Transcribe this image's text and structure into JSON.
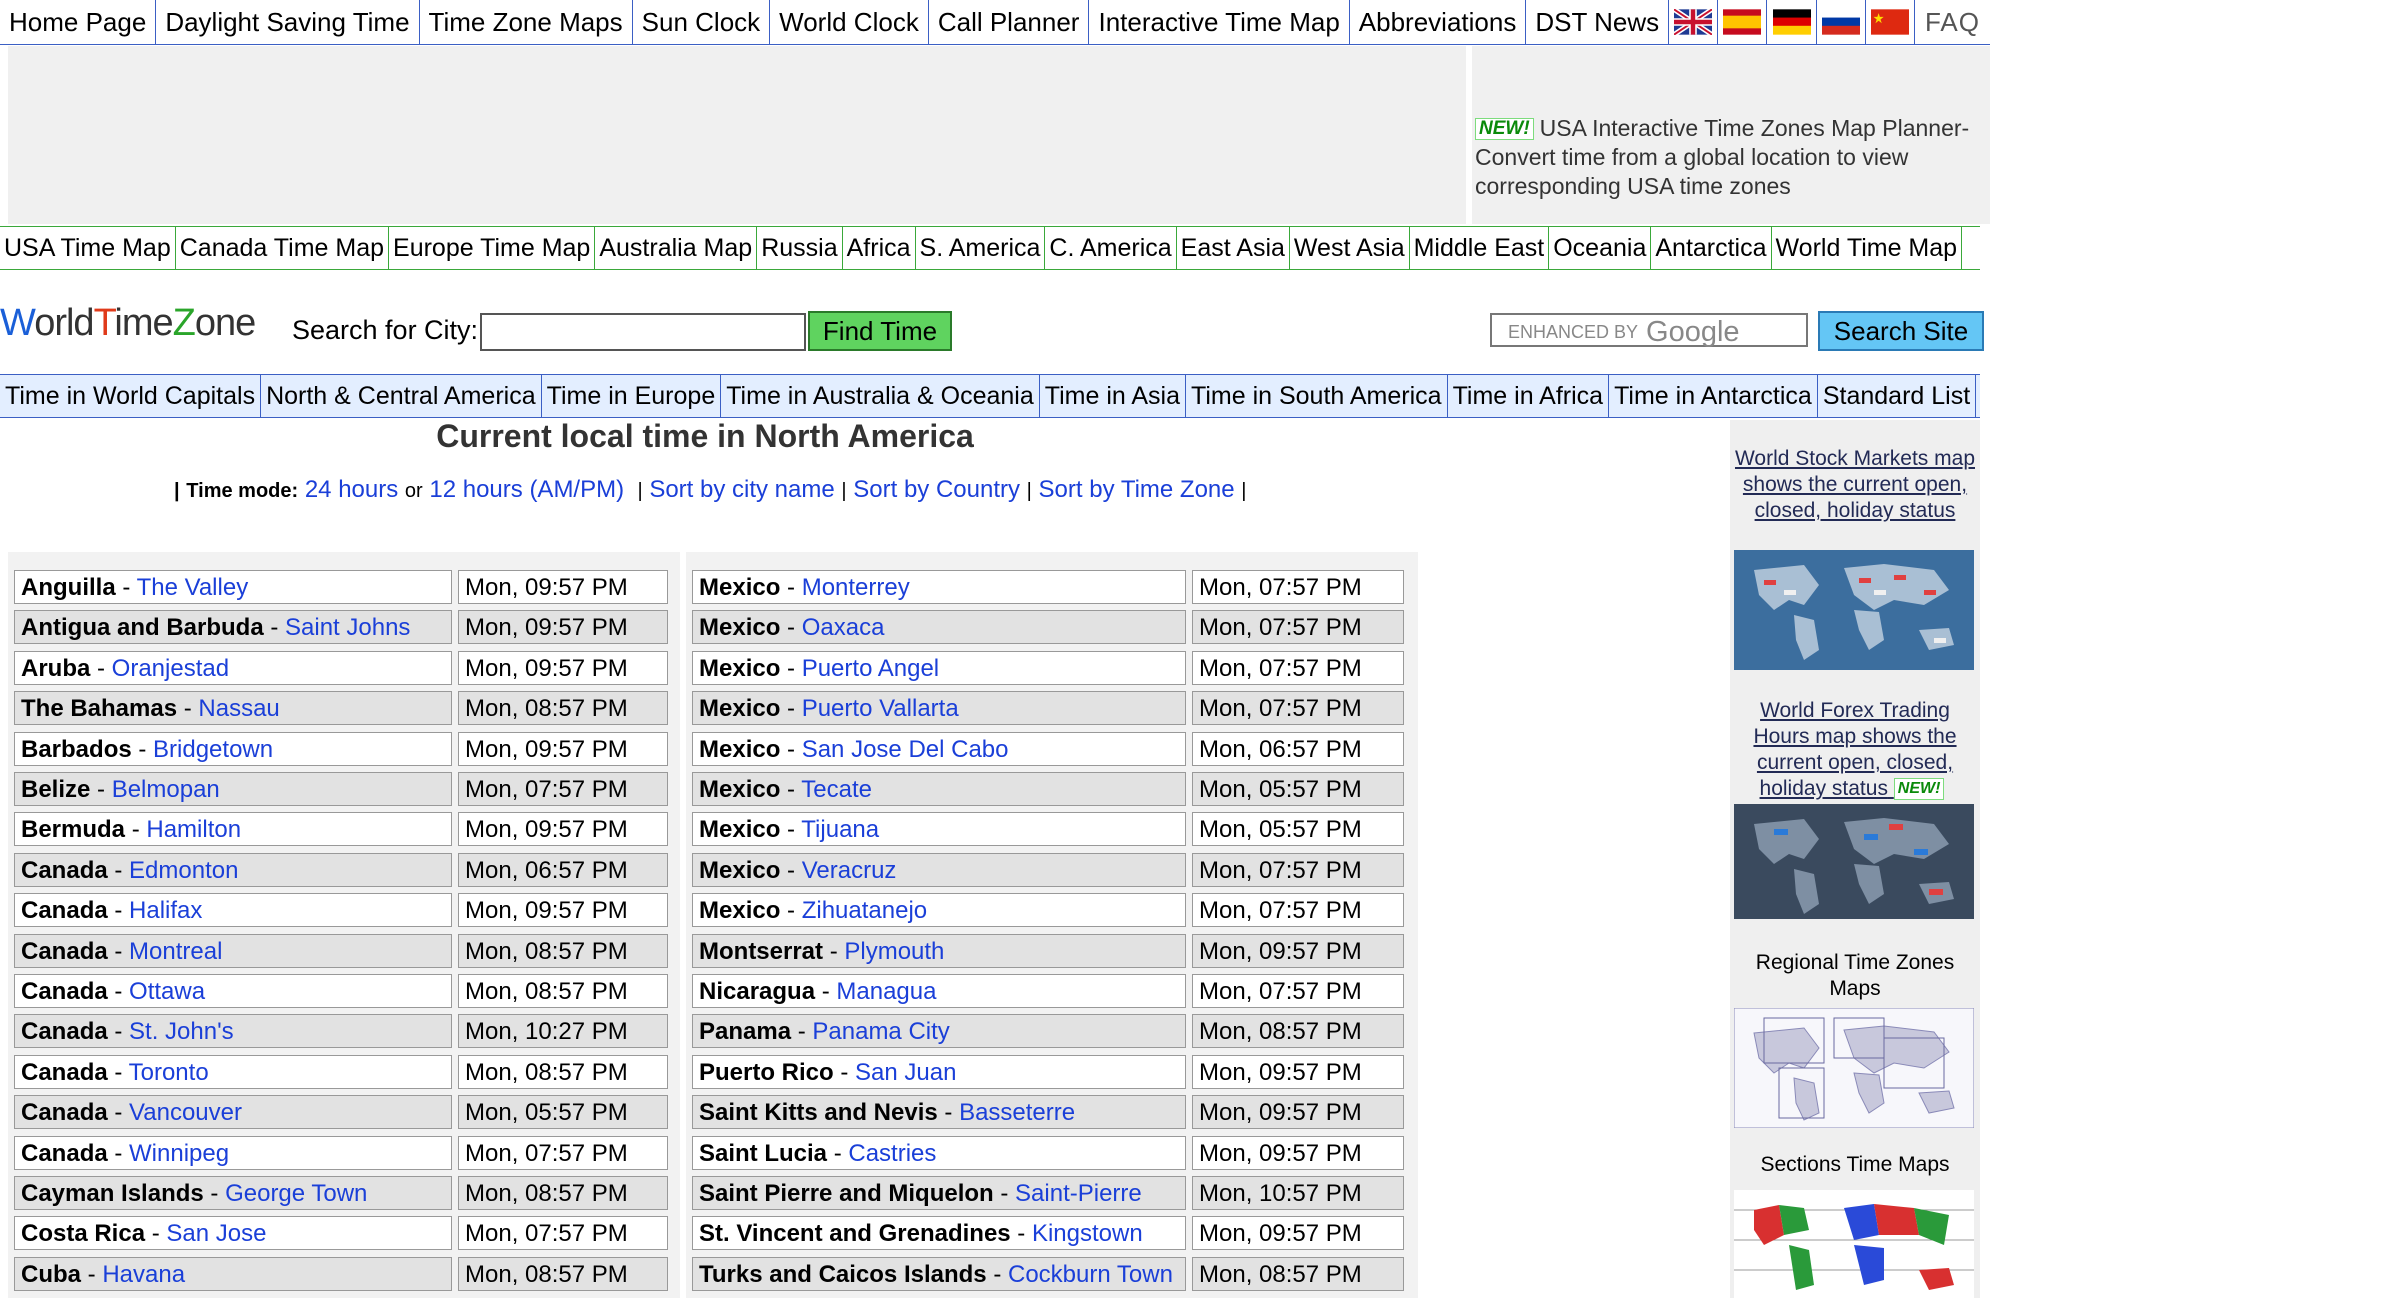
{
  "top_nav": [
    "Home Page",
    "Daylight Saving Time",
    "Time Zone Maps",
    "Sun Clock",
    "World Clock",
    "Call Planner",
    "Interactive Time Map",
    "Abbreviations",
    "DST News"
  ],
  "flags": [
    "uk-flag-icon",
    "spain-flag-icon",
    "germany-flag-icon",
    "russia-flag-icon",
    "china-flag-icon"
  ],
  "faq_label": "FAQ",
  "ad": {
    "badge": "NEW!",
    "text": "USA Interactive Time Zones Map Planner- Convert time from a global location to view corresponding USA time zones"
  },
  "region_nav": [
    "USA Time Map",
    "Canada Time Map",
    "Europe Time Map",
    "Australia Map",
    "Russia",
    "Africa",
    "S. America",
    "C. America",
    "East Asia",
    "West Asia",
    "Middle East",
    "Oceania",
    "Antarctica",
    "World Time Map"
  ],
  "logo": {
    "part1": "W",
    "part2": "orld",
    "part3": "T",
    "part4": "ime",
    "part5": "Z",
    "part6": "one"
  },
  "search": {
    "label": "Search for City:",
    "value": "",
    "button": "Find Time"
  },
  "google": {
    "enhanced": "ENHANCED BY",
    "brand": "Google",
    "button": "Search Site"
  },
  "continent_nav": [
    "Time in World Capitals",
    "North & Central America",
    "Time in Europe",
    "Time in Australia & Oceania",
    "Time in Asia",
    "Time in South America",
    "Time in Africa",
    "Time in Antarctica",
    "Standard List"
  ],
  "heading": "Current local time in North America",
  "mode": {
    "pipe": "|",
    "label": "Time mode:",
    "h24": "24 hours",
    "or": "or",
    "h12": "12 hours (AM/PM)",
    "sort_city": "Sort by city name",
    "sort_country": "Sort by Country",
    "sort_zone": "Sort by Time Zone"
  },
  "left_rows": [
    {
      "country": "Anguilla",
      "city": "The Valley",
      "time": "Mon, 09:57 PM"
    },
    {
      "country": "Antigua and Barbuda",
      "city": "Saint Johns",
      "time": "Mon, 09:57 PM"
    },
    {
      "country": "Aruba",
      "city": "Oranjestad",
      "time": "Mon, 09:57 PM"
    },
    {
      "country": "The Bahamas",
      "city": "Nassau",
      "time": "Mon, 08:57 PM"
    },
    {
      "country": "Barbados",
      "city": "Bridgetown",
      "time": "Mon, 09:57 PM"
    },
    {
      "country": "Belize",
      "city": "Belmopan",
      "time": "Mon, 07:57 PM"
    },
    {
      "country": "Bermuda",
      "city": "Hamilton",
      "time": "Mon, 09:57 PM"
    },
    {
      "country": "Canada",
      "city": "Edmonton",
      "time": "Mon, 06:57 PM"
    },
    {
      "country": "Canada",
      "city": "Halifax",
      "time": "Mon, 09:57 PM"
    },
    {
      "country": "Canada",
      "city": "Montreal",
      "time": "Mon, 08:57 PM"
    },
    {
      "country": "Canada",
      "city": "Ottawa",
      "time": "Mon, 08:57 PM"
    },
    {
      "country": "Canada",
      "city": "St. John's",
      "time": "Mon, 10:27 PM"
    },
    {
      "country": "Canada",
      "city": "Toronto",
      "time": "Mon, 08:57 PM"
    },
    {
      "country": "Canada",
      "city": "Vancouver",
      "time": "Mon, 05:57 PM"
    },
    {
      "country": "Canada",
      "city": "Winnipeg",
      "time": "Mon, 07:57 PM"
    },
    {
      "country": "Cayman Islands",
      "city": "George Town",
      "time": "Mon, 08:57 PM"
    },
    {
      "country": "Costa Rica",
      "city": "San Jose",
      "time": "Mon, 07:57 PM"
    },
    {
      "country": "Cuba",
      "city": "Havana",
      "time": "Mon, 08:57 PM"
    }
  ],
  "right_rows": [
    {
      "country": "Mexico",
      "city": "Monterrey",
      "time": "Mon, 07:57 PM"
    },
    {
      "country": "Mexico",
      "city": "Oaxaca",
      "time": "Mon, 07:57 PM"
    },
    {
      "country": "Mexico",
      "city": "Puerto Angel",
      "time": "Mon, 07:57 PM"
    },
    {
      "country": "Mexico",
      "city": "Puerto Vallarta",
      "time": "Mon, 07:57 PM"
    },
    {
      "country": "Mexico",
      "city": "San Jose Del Cabo",
      "time": "Mon, 06:57 PM"
    },
    {
      "country": "Mexico",
      "city": "Tecate",
      "time": "Mon, 05:57 PM"
    },
    {
      "country": "Mexico",
      "city": "Tijuana",
      "time": "Mon, 05:57 PM"
    },
    {
      "country": "Mexico",
      "city": "Veracruz",
      "time": "Mon, 07:57 PM"
    },
    {
      "country": "Mexico",
      "city": "Zihuatanejo",
      "time": "Mon, 07:57 PM"
    },
    {
      "country": "Montserrat",
      "city": "Plymouth",
      "time": "Mon, 09:57 PM"
    },
    {
      "country": "Nicaragua",
      "city": "Managua",
      "time": "Mon, 07:57 PM"
    },
    {
      "country": "Panama",
      "city": "Panama City",
      "time": "Mon, 08:57 PM"
    },
    {
      "country": "Puerto Rico",
      "city": "San Juan",
      "time": "Mon, 09:57 PM"
    },
    {
      "country": "Saint Kitts and Nevis",
      "city": "Basseterre",
      "time": "Mon, 09:57 PM"
    },
    {
      "country": "Saint Lucia",
      "city": "Castries",
      "time": "Mon, 09:57 PM"
    },
    {
      "country": "Saint Pierre and Miquelon",
      "city": "Saint-Pierre",
      "time": "Mon, 10:57 PM"
    },
    {
      "country": "St. Vincent and Grenadines",
      "city": "Kingstown",
      "time": "Mon, 09:57 PM"
    },
    {
      "country": "Turks and Caicos Islands",
      "city": "Cockburn Town",
      "time": "Mon, 08:57 PM"
    }
  ],
  "sidebar": {
    "stock": "World Stock Markets map shows the current open, closed, holiday status",
    "forex": "World Forex Trading Hours map shows the current open, closed, holiday status",
    "forex_badge": "NEW!",
    "regional": "Regional Time Zones Maps",
    "sections": "Sections Time Maps"
  },
  "colors": {
    "nav_border": "#3b5fc4",
    "region_border": "#3aa83a",
    "link": "#1a3fd8",
    "find_button": "#5fd35f",
    "search_button": "#64c6f5"
  }
}
